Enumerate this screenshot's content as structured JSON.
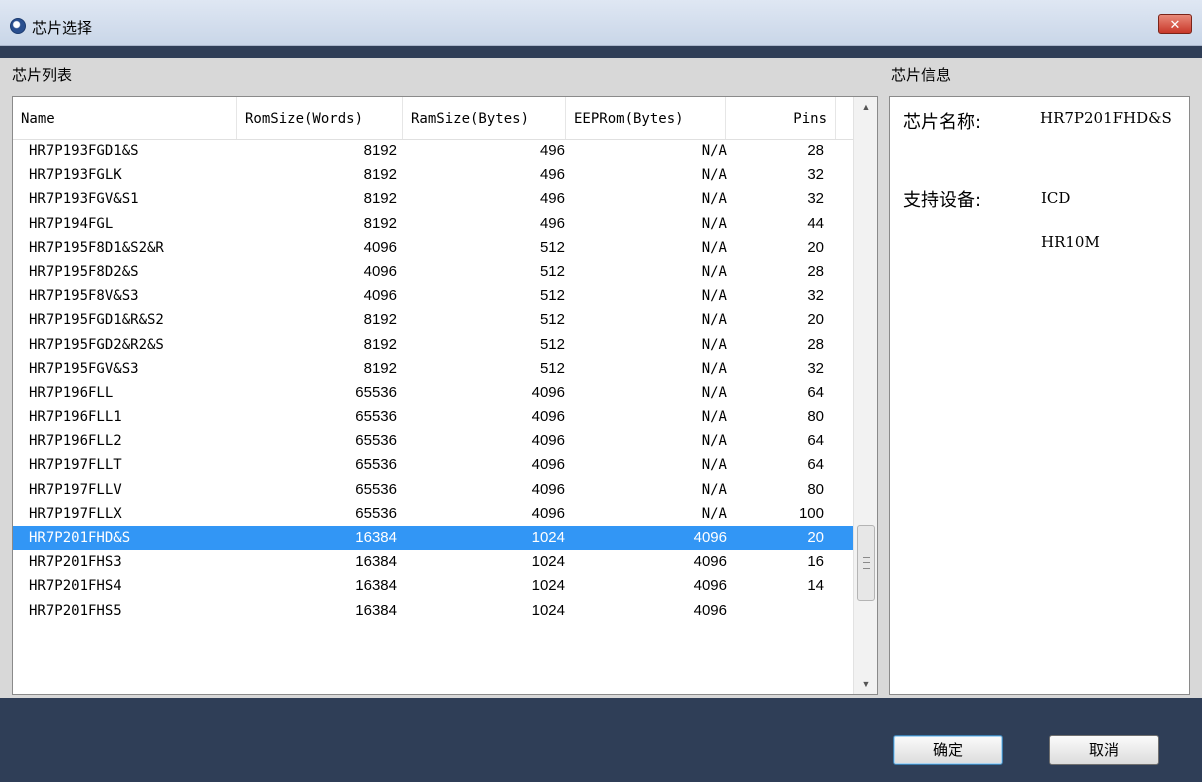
{
  "window": {
    "title": "芯片选择",
    "close_label": "✕"
  },
  "chip_list": {
    "label": "芯片列表",
    "columns": [
      "Name",
      "RomSize(Words)",
      "RamSize(Bytes)",
      "EEPRom(Bytes)",
      "Pins"
    ],
    "selected_index": 16,
    "rows": [
      {
        "name": "HR7P193FGD1&S",
        "rom": "8192",
        "ram": "496",
        "eeprom": "N/A",
        "pins": "28"
      },
      {
        "name": "HR7P193FGLK",
        "rom": "8192",
        "ram": "496",
        "eeprom": "N/A",
        "pins": "32"
      },
      {
        "name": "HR7P193FGV&S1",
        "rom": "8192",
        "ram": "496",
        "eeprom": "N/A",
        "pins": "32"
      },
      {
        "name": "HR7P194FGL",
        "rom": "8192",
        "ram": "496",
        "eeprom": "N/A",
        "pins": "44"
      },
      {
        "name": "HR7P195F8D1&S2&R",
        "rom": "4096",
        "ram": "512",
        "eeprom": "N/A",
        "pins": "20"
      },
      {
        "name": "HR7P195F8D2&S",
        "rom": "4096",
        "ram": "512",
        "eeprom": "N/A",
        "pins": "28"
      },
      {
        "name": "HR7P195F8V&S3",
        "rom": "4096",
        "ram": "512",
        "eeprom": "N/A",
        "pins": "32"
      },
      {
        "name": "HR7P195FGD1&R&S2",
        "rom": "8192",
        "ram": "512",
        "eeprom": "N/A",
        "pins": "20"
      },
      {
        "name": "HR7P195FGD2&R2&S",
        "rom": "8192",
        "ram": "512",
        "eeprom": "N/A",
        "pins": "28"
      },
      {
        "name": "HR7P195FGV&S3",
        "rom": "8192",
        "ram": "512",
        "eeprom": "N/A",
        "pins": "32"
      },
      {
        "name": "HR7P196FLL",
        "rom": "65536",
        "ram": "4096",
        "eeprom": "N/A",
        "pins": "64"
      },
      {
        "name": "HR7P196FLL1",
        "rom": "65536",
        "ram": "4096",
        "eeprom": "N/A",
        "pins": "80"
      },
      {
        "name": "HR7P196FLL2",
        "rom": "65536",
        "ram": "4096",
        "eeprom": "N/A",
        "pins": "64"
      },
      {
        "name": "HR7P197FLLT",
        "rom": "65536",
        "ram": "4096",
        "eeprom": "N/A",
        "pins": "64"
      },
      {
        "name": "HR7P197FLLV",
        "rom": "65536",
        "ram": "4096",
        "eeprom": "N/A",
        "pins": "80"
      },
      {
        "name": "HR7P197FLLX",
        "rom": "65536",
        "ram": "4096",
        "eeprom": "N/A",
        "pins": "100"
      },
      {
        "name": "HR7P201FHD&S",
        "rom": "16384",
        "ram": "1024",
        "eeprom": "4096",
        "pins": "20"
      },
      {
        "name": "HR7P201FHS3",
        "rom": "16384",
        "ram": "1024",
        "eeprom": "4096",
        "pins": "16"
      },
      {
        "name": "HR7P201FHS4",
        "rom": "16384",
        "ram": "1024",
        "eeprom": "4096",
        "pins": "14"
      },
      {
        "name": "HR7P201FHS5",
        "rom": "16384",
        "ram": "1024",
        "eeprom": "4096",
        "pins": ""
      }
    ]
  },
  "chip_info": {
    "label": "芯片信息",
    "name_label": "芯片名称:",
    "name_value": "HR7P201FHD&S",
    "devices_label": "支持设备:",
    "devices": [
      "ICD",
      "HR10M"
    ]
  },
  "buttons": {
    "ok": "确定",
    "cancel": "取消"
  }
}
